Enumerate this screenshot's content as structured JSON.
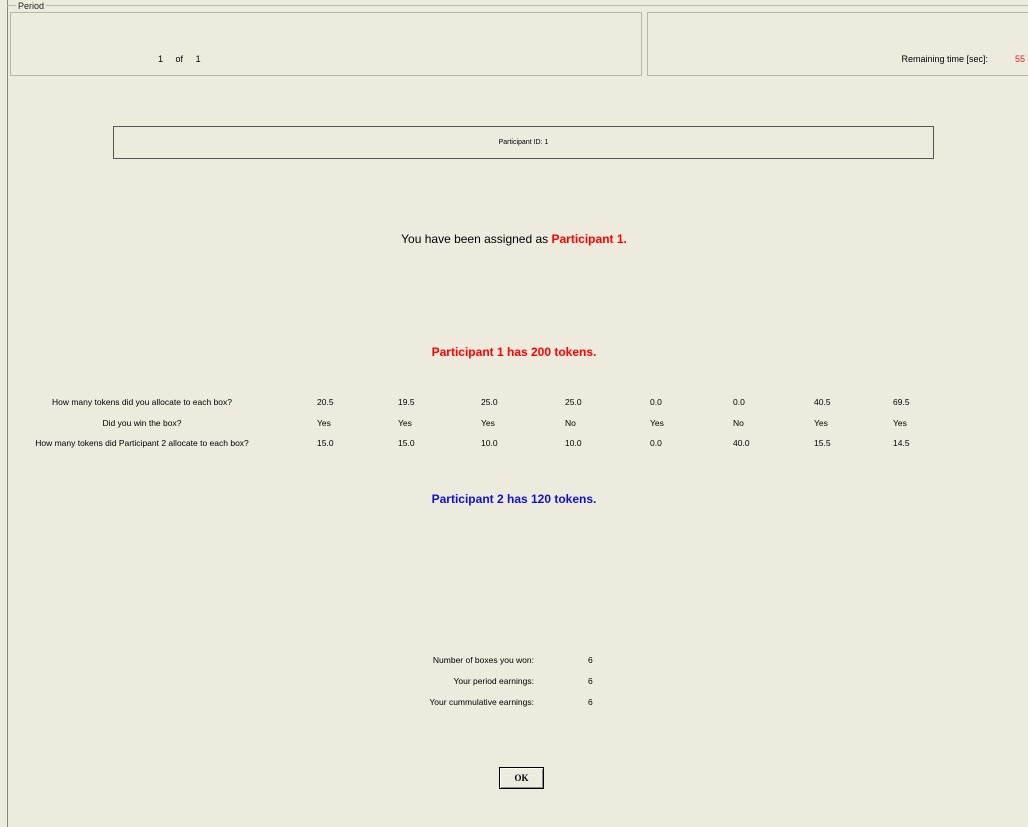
{
  "period": {
    "legend": "Period",
    "current": "1",
    "of_label": "of",
    "total": "1"
  },
  "timer": {
    "label": "Remaining time [sec]:",
    "value": "55"
  },
  "participant_id_label": "Participant ID: 1",
  "assignment": {
    "prefix": "You have been assigned as ",
    "role": "Participant 1."
  },
  "p1_tokens": "Participant 1 has 200 tokens.",
  "p2_tokens": "Participant 2 has 120 tokens.",
  "table": {
    "rows": [
      {
        "label": "How many tokens did you allocate to each box?",
        "values": [
          "20.5",
          "19.5",
          "25.0",
          "25.0",
          "0.0",
          "0.0",
          "40.5",
          "69.5"
        ]
      },
      {
        "label": "Did you win the box?",
        "values": [
          "Yes",
          "Yes",
          "Yes",
          "No",
          "Yes",
          "No",
          "Yes",
          "Yes"
        ]
      },
      {
        "label": "How many tokens did Participant 2 allocate to each box?",
        "values": [
          "15.0",
          "15.0",
          "10.0",
          "10.0",
          "0.0",
          "40.0",
          "15.5",
          "14.5"
        ]
      }
    ]
  },
  "summary": [
    {
      "label": "Number of boxes you won:",
      "value": "6"
    },
    {
      "label": "Your period earnings:",
      "value": "6"
    },
    {
      "label": "Your cummulative earnings:",
      "value": "6"
    }
  ],
  "ok_label": "OK"
}
